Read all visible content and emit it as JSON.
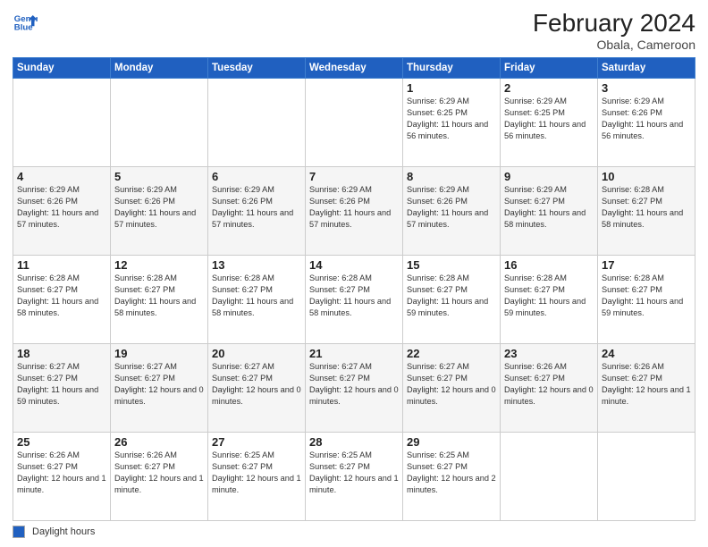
{
  "logo": {
    "line1": "General",
    "line2": "Blue"
  },
  "title": "February 2024",
  "subtitle": "Obala, Cameroon",
  "days_of_week": [
    "Sunday",
    "Monday",
    "Tuesday",
    "Wednesday",
    "Thursday",
    "Friday",
    "Saturday"
  ],
  "footer_legend": "Daylight hours",
  "weeks": [
    [
      {
        "day": "",
        "info": ""
      },
      {
        "day": "",
        "info": ""
      },
      {
        "day": "",
        "info": ""
      },
      {
        "day": "",
        "info": ""
      },
      {
        "day": "1",
        "info": "Sunrise: 6:29 AM\nSunset: 6:25 PM\nDaylight: 11 hours\nand 56 minutes."
      },
      {
        "day": "2",
        "info": "Sunrise: 6:29 AM\nSunset: 6:25 PM\nDaylight: 11 hours\nand 56 minutes."
      },
      {
        "day": "3",
        "info": "Sunrise: 6:29 AM\nSunset: 6:26 PM\nDaylight: 11 hours\nand 56 minutes."
      }
    ],
    [
      {
        "day": "4",
        "info": "Sunrise: 6:29 AM\nSunset: 6:26 PM\nDaylight: 11 hours\nand 57 minutes."
      },
      {
        "day": "5",
        "info": "Sunrise: 6:29 AM\nSunset: 6:26 PM\nDaylight: 11 hours\nand 57 minutes."
      },
      {
        "day": "6",
        "info": "Sunrise: 6:29 AM\nSunset: 6:26 PM\nDaylight: 11 hours\nand 57 minutes."
      },
      {
        "day": "7",
        "info": "Sunrise: 6:29 AM\nSunset: 6:26 PM\nDaylight: 11 hours\nand 57 minutes."
      },
      {
        "day": "8",
        "info": "Sunrise: 6:29 AM\nSunset: 6:26 PM\nDaylight: 11 hours\nand 57 minutes."
      },
      {
        "day": "9",
        "info": "Sunrise: 6:29 AM\nSunset: 6:27 PM\nDaylight: 11 hours\nand 58 minutes."
      },
      {
        "day": "10",
        "info": "Sunrise: 6:28 AM\nSunset: 6:27 PM\nDaylight: 11 hours\nand 58 minutes."
      }
    ],
    [
      {
        "day": "11",
        "info": "Sunrise: 6:28 AM\nSunset: 6:27 PM\nDaylight: 11 hours\nand 58 minutes."
      },
      {
        "day": "12",
        "info": "Sunrise: 6:28 AM\nSunset: 6:27 PM\nDaylight: 11 hours\nand 58 minutes."
      },
      {
        "day": "13",
        "info": "Sunrise: 6:28 AM\nSunset: 6:27 PM\nDaylight: 11 hours\nand 58 minutes."
      },
      {
        "day": "14",
        "info": "Sunrise: 6:28 AM\nSunset: 6:27 PM\nDaylight: 11 hours\nand 58 minutes."
      },
      {
        "day": "15",
        "info": "Sunrise: 6:28 AM\nSunset: 6:27 PM\nDaylight: 11 hours\nand 59 minutes."
      },
      {
        "day": "16",
        "info": "Sunrise: 6:28 AM\nSunset: 6:27 PM\nDaylight: 11 hours\nand 59 minutes."
      },
      {
        "day": "17",
        "info": "Sunrise: 6:28 AM\nSunset: 6:27 PM\nDaylight: 11 hours\nand 59 minutes."
      }
    ],
    [
      {
        "day": "18",
        "info": "Sunrise: 6:27 AM\nSunset: 6:27 PM\nDaylight: 11 hours\nand 59 minutes."
      },
      {
        "day": "19",
        "info": "Sunrise: 6:27 AM\nSunset: 6:27 PM\nDaylight: 12 hours\nand 0 minutes."
      },
      {
        "day": "20",
        "info": "Sunrise: 6:27 AM\nSunset: 6:27 PM\nDaylight: 12 hours\nand 0 minutes."
      },
      {
        "day": "21",
        "info": "Sunrise: 6:27 AM\nSunset: 6:27 PM\nDaylight: 12 hours\nand 0 minutes."
      },
      {
        "day": "22",
        "info": "Sunrise: 6:27 AM\nSunset: 6:27 PM\nDaylight: 12 hours\nand 0 minutes."
      },
      {
        "day": "23",
        "info": "Sunrise: 6:26 AM\nSunset: 6:27 PM\nDaylight: 12 hours\nand 0 minutes."
      },
      {
        "day": "24",
        "info": "Sunrise: 6:26 AM\nSunset: 6:27 PM\nDaylight: 12 hours\nand 1 minute."
      }
    ],
    [
      {
        "day": "25",
        "info": "Sunrise: 6:26 AM\nSunset: 6:27 PM\nDaylight: 12 hours\nand 1 minute."
      },
      {
        "day": "26",
        "info": "Sunrise: 6:26 AM\nSunset: 6:27 PM\nDaylight: 12 hours\nand 1 minute."
      },
      {
        "day": "27",
        "info": "Sunrise: 6:25 AM\nSunset: 6:27 PM\nDaylight: 12 hours\nand 1 minute."
      },
      {
        "day": "28",
        "info": "Sunrise: 6:25 AM\nSunset: 6:27 PM\nDaylight: 12 hours\nand 1 minute."
      },
      {
        "day": "29",
        "info": "Sunrise: 6:25 AM\nSunset: 6:27 PM\nDaylight: 12 hours\nand 2 minutes."
      },
      {
        "day": "",
        "info": ""
      },
      {
        "day": "",
        "info": ""
      }
    ]
  ]
}
